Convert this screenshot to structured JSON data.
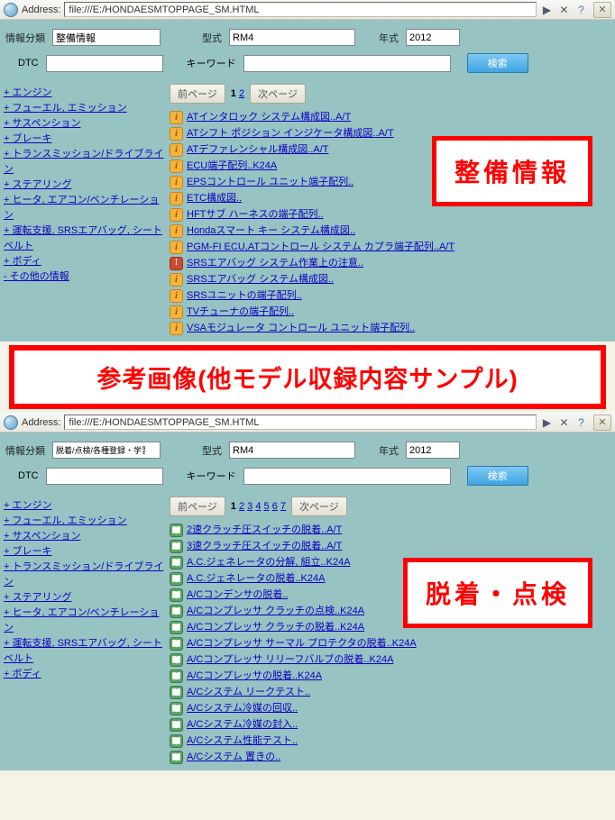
{
  "addr": {
    "label": "Address:",
    "url": "file:///E:/HONDAESMTOPPAGE_SM.HTML"
  },
  "labels": {
    "info_class": "情報分類",
    "model": "型式",
    "year": "年式",
    "dtc": "DTC",
    "keyword": "キーワード",
    "search": "検索",
    "prev": "前ページ",
    "next": "次ページ"
  },
  "panel1": {
    "filters": {
      "info_class": "整備情報",
      "model": "RM4",
      "year": "2012"
    },
    "overlay": "整備情報",
    "pages": [
      "1",
      "2"
    ],
    "current_page": "1",
    "sidebar": [
      "+ エンジン",
      "+ フューエル, エミッション",
      "+ サスペンション",
      "+ ブレーキ",
      "+ トランスミッション/ドライブライン",
      "+ ステアリング",
      "+ ヒータ, エアコン/ベンチレーション",
      "+ 運転支援, SRSエアバッグ, シート ベルト",
      "+ ボディ",
      "- その他の情報"
    ],
    "results": [
      {
        "icon": "info",
        "text": "ATインタロック システム構成図..A/T"
      },
      {
        "icon": "info",
        "text": "ATシフト ポジション インジケータ構成図..A/T"
      },
      {
        "icon": "info",
        "text": "ATデファレンシャル構成図..A/T"
      },
      {
        "icon": "info",
        "text": "ECU端子配列..K24A"
      },
      {
        "icon": "info",
        "text": "EPSコントロール ユニット端子配列.."
      },
      {
        "icon": "info",
        "text": "ETC構成図.."
      },
      {
        "icon": "info",
        "text": "HFTサブ ハーネスの端子配列.."
      },
      {
        "icon": "info",
        "text": "Hondaスマート キー システム構成図.."
      },
      {
        "icon": "info",
        "text": "PGM-FI ECU,ATコントロール システム カプラ端子配列..A/T"
      },
      {
        "icon": "warn",
        "text": "SRSエアバッグ システム作業上の注意.."
      },
      {
        "icon": "info",
        "text": "SRSエアバッグ システム構成図.."
      },
      {
        "icon": "info",
        "text": "SRSユニットの端子配列.."
      },
      {
        "icon": "info",
        "text": "TVチューナの端子配列.."
      },
      {
        "icon": "info",
        "text": "VSAモジュレータ コントロール ユニット端子配列.."
      }
    ]
  },
  "mid_banner": "参考画像(他モデル収録内容サンプル)",
  "panel2": {
    "filters": {
      "info_class": "脱着/点検/各種登録・学習",
      "model": "RM4",
      "year": "2012"
    },
    "overlay": "脱着・点検",
    "pages": [
      "1",
      "2",
      "3",
      "4",
      "5",
      "6",
      "7"
    ],
    "current_page": "1",
    "sidebar": [
      "+ エンジン",
      "+ フューエル, エミッション",
      "+ サスペンション",
      "+ ブレーキ",
      "+ トランスミッション/ドライブライン",
      "+ ステアリング",
      "+ ヒータ, エアコン/ベンチレーション",
      "+ 運転支援, SRSエアバッグ, シート ベルト",
      "+ ボディ"
    ],
    "results": [
      {
        "icon": "book",
        "text": "2速クラッチ圧スイッチの脱着..A/T"
      },
      {
        "icon": "book",
        "text": "3速クラッチ圧スイッチの脱着..A/T"
      },
      {
        "icon": "book",
        "text": "A.C.ジェネレータの分解, 組立..K24A"
      },
      {
        "icon": "book",
        "text": "A.C.ジェネレータの脱着..K24A"
      },
      {
        "icon": "book",
        "text": "A/Cコンデンサの脱着.."
      },
      {
        "icon": "book",
        "text": "A/Cコンプレッサ クラッチの点検..K24A"
      },
      {
        "icon": "book",
        "text": "A/Cコンプレッサ クラッチの脱着..K24A"
      },
      {
        "icon": "book",
        "text": "A/Cコンプレッサ サーマル プロテクタの脱着..K24A"
      },
      {
        "icon": "book",
        "text": "A/Cコンプレッサ リリーフバルブの脱着..K24A"
      },
      {
        "icon": "book",
        "text": "A/Cコンプレッサの脱着..K24A"
      },
      {
        "icon": "book",
        "text": "A/Cシステム リークテスト.."
      },
      {
        "icon": "book",
        "text": "A/Cシステム冷媒の回収.."
      },
      {
        "icon": "book",
        "text": "A/Cシステム冷媒の封入.."
      },
      {
        "icon": "book",
        "text": "A/Cシステム性能テスト.."
      },
      {
        "icon": "book",
        "text": "A/Cシステム 置きの.."
      }
    ]
  }
}
